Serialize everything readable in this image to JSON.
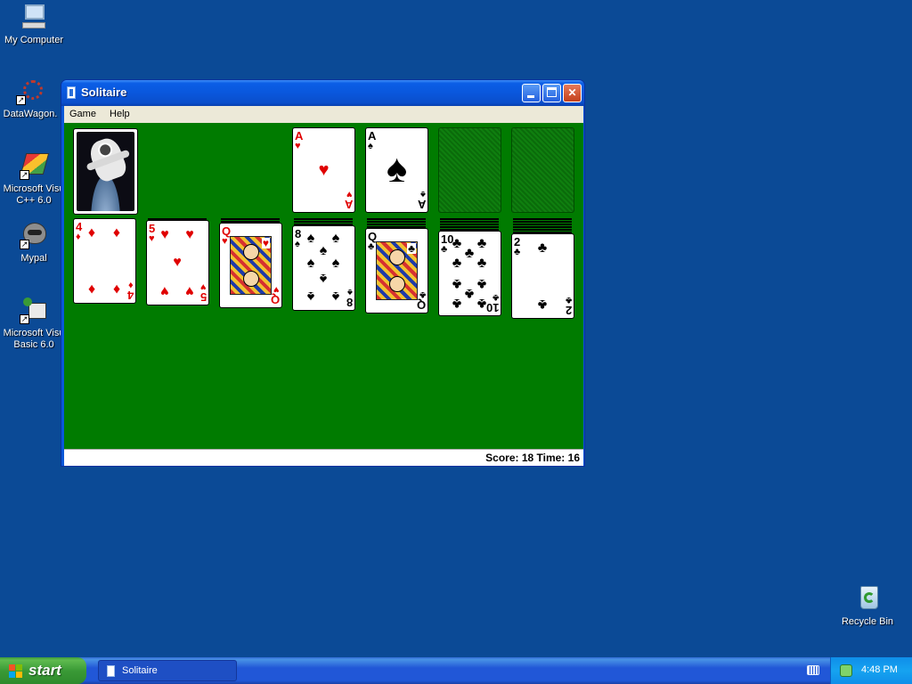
{
  "desktop": {
    "icons": [
      {
        "label": "My Computer",
        "icon": "my-computer-icon"
      },
      {
        "label": "DataWagon.",
        "icon": "datawagon-icon"
      },
      {
        "label": "Microsoft Visu C++ 6.0",
        "icon": "visual-cpp-icon"
      },
      {
        "label": "Mypal",
        "icon": "mypal-icon"
      },
      {
        "label": "Microsoft Visu Basic 6.0",
        "icon": "visual-basic-icon"
      },
      {
        "label": "Recycle Bin",
        "icon": "recycle-bin-icon"
      }
    ]
  },
  "window": {
    "title": "Solitaire",
    "menu": [
      "Game",
      "Help"
    ],
    "status": "Score: 18 Time: 16"
  },
  "game": {
    "foundations": [
      {
        "rank": "A",
        "suit": "♥",
        "color": "red"
      },
      {
        "rank": "A",
        "suit": "♠",
        "color": "black"
      },
      {
        "empty": true
      },
      {
        "empty": true
      }
    ],
    "tableau": [
      {
        "rank": "4",
        "suit": "♦",
        "color": "red"
      },
      {
        "rank": "5",
        "suit": "♥",
        "color": "red"
      },
      {
        "rank": "Q",
        "suit": "♥",
        "color": "red"
      },
      {
        "rank": "8",
        "suit": "♠",
        "color": "black"
      },
      {
        "rank": "Q",
        "suit": "♣",
        "color": "black"
      },
      {
        "rank": "10",
        "suit": "♣",
        "color": "black"
      },
      {
        "rank": "2",
        "suit": "♣",
        "color": "black"
      }
    ]
  },
  "taskbar": {
    "start_label": "start",
    "task_label": "Solitaire",
    "clock": "4:48 PM"
  },
  "colors": {
    "desktop": "#0b4a96",
    "felt": "#007b00",
    "red_suit": "#e00000"
  }
}
